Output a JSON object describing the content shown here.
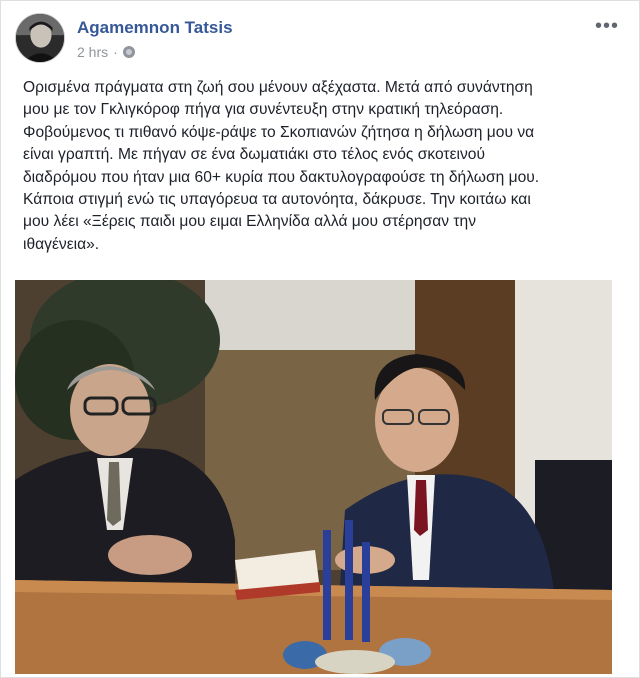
{
  "post": {
    "author": "Agamemnon Tatsis",
    "time": "2 hrs",
    "dot": "·",
    "privacy_icon": "globe-icon",
    "more_label": "•••",
    "body_lines": [
      "Ορισμένα πράγματα στη ζωή σου μένουν αξέχαστα. Μετά από συνάντηση",
      "μου με τον Γκλιγκόροφ πήγα για συνέντευξη στην κρατική τηλεόραση.",
      "Φοβούμενος τι πιθανό κόψε-ράψε το Σκοπιανών ζήτησα η δήλωση μου να",
      "είναι γραπτή. Με πήγαν σε ένα δωματιάκι στο τέλος ενός σκοτεινού",
      "διαδρόμου που ήταν μια 60+ κυρία που δακτυλογραφούσε τη δήλωση μου.",
      "Κάποια στιγμή ενώ τις υπαγόρευα τα αυτονόητα, δάκρυσε. Την κοιτάω και",
      "μου λέει «Ξέρεις παιδι μου ειμαι Ελληνίδα αλλά μου στέρησαν την",
      "ιθαγένεια»."
    ]
  },
  "colors": {
    "author_link": "#365899",
    "meta_gray": "#90949c",
    "text": "#1d2129"
  }
}
